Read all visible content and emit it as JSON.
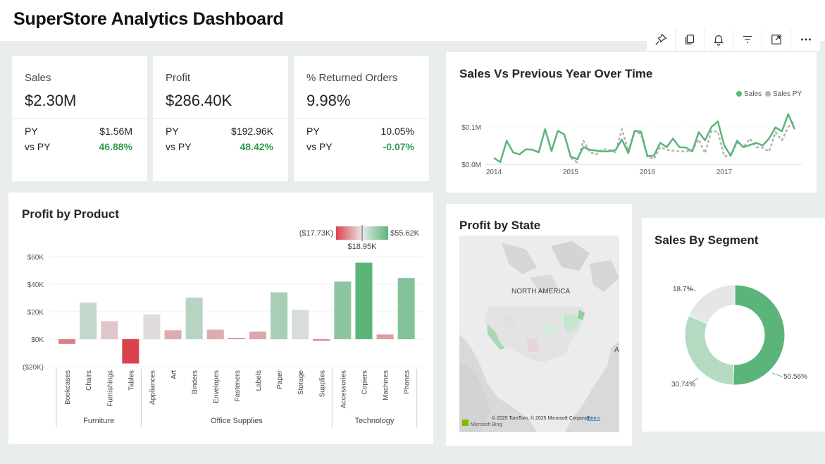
{
  "page": {
    "title": "SuperStore Analytics Dashboard"
  },
  "toolbar": {
    "items": [
      {
        "name": "pin",
        "icon": "pin-icon"
      },
      {
        "name": "copy",
        "icon": "copy-icon"
      },
      {
        "name": "alert",
        "icon": "bell-icon"
      },
      {
        "name": "filter",
        "icon": "filter-icon"
      },
      {
        "name": "focus",
        "icon": "expand-icon"
      },
      {
        "name": "more",
        "icon": "more-icon"
      }
    ]
  },
  "kpis": [
    {
      "label": "Sales",
      "value": "$2.30M",
      "py_label": "PY",
      "py_value": "$1.56M",
      "vs_label": "vs PY",
      "vs_value": "46.88%"
    },
    {
      "label": "Profit",
      "value": "$286.40K",
      "py_label": "PY",
      "py_value": "$192.96K",
      "vs_label": "vs PY",
      "vs_value": "48.42%"
    },
    {
      "label": "% Returned Orders",
      "value": "9.98%",
      "py_label": "PY",
      "py_value": "10.05%",
      "vs_label": "vs PY",
      "vs_value": "-0.07%"
    }
  ],
  "colors": {
    "positive": "#2e9e4d",
    "sales_line": "#5bb57a",
    "sales_py_line": "#b3b3b3",
    "gradient_low": "#d9434e",
    "gradient_mid": "#e0e0e0",
    "gradient_high": "#5bb57a"
  },
  "profit_by_product": {
    "title": "Profit by Product",
    "legend_min": "($17.73K)",
    "legend_mid": "$18.95K",
    "legend_max": "$55.62K",
    "y_ticks": [
      "$60K",
      "$40K",
      "$20K",
      "$0K",
      "($20K)"
    ],
    "groups": [
      {
        "name": "Furniture",
        "count": 4
      },
      {
        "name": "Office Supplies",
        "count": 9
      },
      {
        "name": "Technology",
        "count": 4
      }
    ]
  },
  "sales_over_time": {
    "title": "Sales Vs Previous Year Over Time",
    "legend": [
      "Sales",
      "Sales PY"
    ],
    "y_ticks": [
      "$0.1M",
      "$0.0M"
    ],
    "x_ticks": [
      "2014",
      "2015",
      "2016",
      "2017"
    ]
  },
  "profit_by_state": {
    "title": "Profit by State",
    "map_label": "NORTH AMERICA",
    "attribution": "© 2025 TomTom, © 2025 Microsoft Corporation",
    "terms": "Terms",
    "bing": "Microsoft Bing"
  },
  "sales_by_segment": {
    "title": "Sales By Segment",
    "labels": [
      "50.56%",
      "30.74%",
      "18.7%"
    ]
  },
  "chart_data": [
    {
      "type": "bar",
      "title": "Profit by Product",
      "categories": [
        "Bookcases",
        "Chairs",
        "Furnishings",
        "Tables",
        "Appliances",
        "Art",
        "Binders",
        "Envelopes",
        "Fasteners",
        "Labels",
        "Paper",
        "Storage",
        "Supplies",
        "Accessories",
        "Copiers",
        "Machines",
        "Phones"
      ],
      "values": [
        -3.5,
        26.6,
        13.1,
        -17.7,
        18.1,
        6.5,
        30.2,
        6.9,
        0.95,
        5.5,
        34.1,
        21.3,
        -1.2,
        41.9,
        55.6,
        3.4,
        44.5
      ],
      "ylim": [
        -20,
        60
      ],
      "ylabel": "",
      "xlabel": ""
    },
    {
      "type": "line",
      "title": "Sales Vs Previous Year Over Time",
      "x": [
        "2014-01",
        "2014-02",
        "2014-03",
        "2014-04",
        "2014-05",
        "2014-06",
        "2014-07",
        "2014-08",
        "2014-09",
        "2014-10",
        "2014-11",
        "2014-12",
        "2015-01",
        "2015-02",
        "2015-03",
        "2015-04",
        "2015-05",
        "2015-06",
        "2015-07",
        "2015-08",
        "2015-09",
        "2015-10",
        "2015-11",
        "2015-12",
        "2016-01",
        "2016-02",
        "2016-03",
        "2016-04",
        "2016-05",
        "2016-06",
        "2016-07",
        "2016-08",
        "2016-09",
        "2016-10",
        "2016-11",
        "2016-12",
        "2017-01",
        "2017-02",
        "2017-03",
        "2017-04",
        "2017-05",
        "2017-06",
        "2017-07",
        "2017-08",
        "2017-09",
        "2017-10",
        "2017-11",
        "2017-12"
      ],
      "series": [
        {
          "name": "Sales",
          "values": [
            0.015,
            0.005,
            0.055,
            0.028,
            0.023,
            0.035,
            0.034,
            0.028,
            0.082,
            0.031,
            0.078,
            0.07,
            0.018,
            0.012,
            0.04,
            0.034,
            0.032,
            0.03,
            0.03,
            0.033,
            0.058,
            0.026,
            0.078,
            0.076,
            0.019,
            0.02,
            0.05,
            0.04,
            0.06,
            0.04,
            0.039,
            0.03,
            0.075,
            0.056,
            0.087,
            0.1,
            0.044,
            0.02,
            0.055,
            0.04,
            0.045,
            0.05,
            0.044,
            0.06,
            0.086,
            0.077,
            0.117,
            0.082
          ]
        },
        {
          "name": "Sales PY",
          "values": [
            null,
            null,
            null,
            null,
            null,
            null,
            null,
            null,
            null,
            null,
            null,
            null,
            0.015,
            0.005,
            0.055,
            0.028,
            0.023,
            0.035,
            0.034,
            0.028,
            0.082,
            0.031,
            0.078,
            0.07,
            0.018,
            0.012,
            0.04,
            0.034,
            0.032,
            0.03,
            0.03,
            0.033,
            0.058,
            0.026,
            0.078,
            0.076,
            0.019,
            0.02,
            0.05,
            0.04,
            0.06,
            0.04,
            0.039,
            0.03,
            0.075,
            0.056,
            0.087,
            0.1
          ]
        }
      ],
      "ylim": [
        0,
        0.13
      ],
      "legend": "top-right"
    },
    {
      "type": "pie",
      "title": "Sales By Segment",
      "values": [
        50.56,
        30.74,
        18.7
      ]
    }
  ]
}
